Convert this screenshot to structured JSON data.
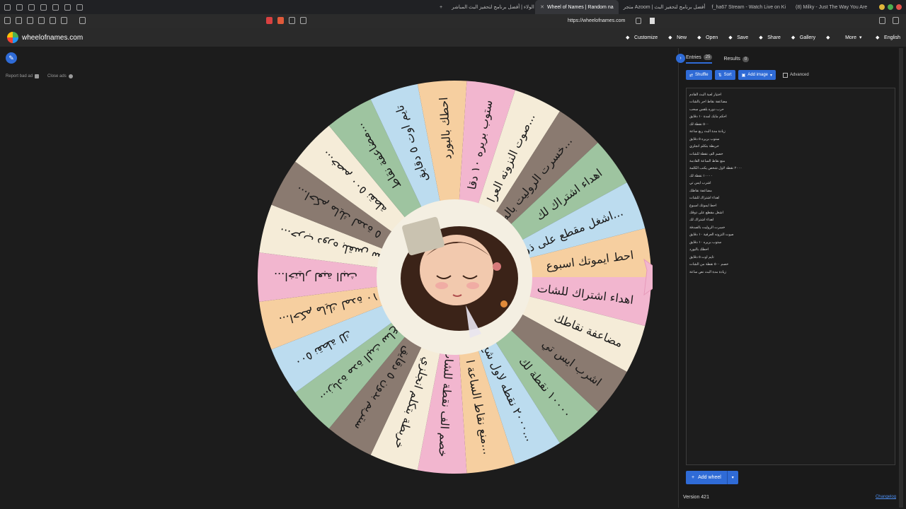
{
  "browser": {
    "tabs": [
      {
        "label": "الولاء | أفضل برنامج لتحفيز البث المباشر",
        "active": false
      },
      {
        "label": "Wheel of Names | Random na",
        "active": true
      },
      {
        "label": "متجر Azoom | أفضل برنامج لتحفيز البث",
        "active": false
      },
      {
        "label": "f_ha67 Stream - Watch Live on Ki",
        "active": false
      },
      {
        "label": "(8) Milky - Just The Way You Are",
        "active": false
      }
    ],
    "url": "https://wheelofnames.com"
  },
  "app": {
    "brand": "wheelofnames.com",
    "menu": [
      {
        "label": "Customize",
        "icon": "palette-icon"
      },
      {
        "label": "New",
        "icon": "file-icon"
      },
      {
        "label": "Open",
        "icon": "folder-icon"
      },
      {
        "label": "Save",
        "icon": "save-icon"
      },
      {
        "label": "Share",
        "icon": "share-icon"
      },
      {
        "label": "Gallery",
        "icon": "search-icon"
      },
      {
        "label": "",
        "icon": "fullscreen-icon"
      },
      {
        "label": "More",
        "icon": "chevron-down-icon"
      },
      {
        "label": "English",
        "icon": "globe-icon"
      }
    ]
  },
  "left": {
    "report_ad": "Report bad ad",
    "close_ads": "Close ads"
  },
  "wheel": {
    "colors": {
      "green": "#9ec4a0",
      "cream": "#f5ecd8",
      "brown": "#8a7a70",
      "blue": "#bcdcef",
      "pink": "#f2b6cf",
      "orange": "#f6cfa0"
    },
    "segments": [
      {
        "label": "احط ايموتك اسبوع",
        "color": "orange"
      },
      {
        "label": "اهداء اشتراك للشات",
        "color": "pink"
      },
      {
        "label": "مضاعفة نقاطك",
        "color": "cream"
      },
      {
        "label": "اشرب ايس تي",
        "color": "brown"
      },
      {
        "label": "١٠٠٠٠ نقطة لك",
        "color": "green"
      },
      {
        "label": "٢٠٠٠ نقطه لاول شخ...",
        "color": "blue"
      },
      {
        "label": "منع نقاط الساعة ا...",
        "color": "orange"
      },
      {
        "label": "خصم الف نقطة للشات",
        "color": "pink"
      },
      {
        "label": "خربطة بتكلم انجلزي",
        "color": "cream"
      },
      {
        "label": "ستريم بدون ٥ دقايق",
        "color": "brown"
      },
      {
        "label": "زيادة مدة البث ساع...",
        "color": "green"
      },
      {
        "label": "٥٠٠ نقطة لك",
        "color": "blue"
      },
      {
        "label": "احكم مايك لمدة ١٠...",
        "color": "orange"
      },
      {
        "label": "اختيار لعبة البث...",
        "color": "pink"
      },
      {
        "label": "حرب دوره بلقس سح...",
        "color": "cream"
      },
      {
        "label": "احكم مايك لمدة ٥...",
        "color": "brown"
      },
      {
        "label": "خصم ٥٠٠ نقطة...",
        "color": "cream"
      },
      {
        "label": "مضاعفة نقاط...",
        "color": "green"
      },
      {
        "label": "تايم اوت ٥ دقايق",
        "color": "blue"
      },
      {
        "label": "احطك بالبورد",
        "color": "orange"
      },
      {
        "label": "ستوب بريره ١٠ دقا",
        "color": "pink"
      },
      {
        "label": "صوت النزونه العرا...",
        "color": "cream"
      },
      {
        "label": "خسرت الروليت باله...",
        "color": "brown"
      },
      {
        "label": "اهداء اشتراك لك",
        "color": "green"
      },
      {
        "label": "اشغل مقطع على ذوق...",
        "color": "blue"
      }
    ]
  },
  "panel": {
    "tabs": [
      {
        "label": "Entries",
        "count": "25"
      },
      {
        "label": "Results",
        "count": "0"
      }
    ],
    "shuffle": "Shuffle",
    "sort": "Sort",
    "add_image": "Add image",
    "advanced": "Advanced",
    "entries": [
      "اختيار لعبة البث القادم",
      "مضاعفة نقاط اجر بالشات",
      "حرب دوره بلقس سحب",
      "احكم مايك لمدة ١٠ دقايق",
      "٥٠٠ نقطة لك",
      "زيادة مدة البث ربع ساعة",
      "ستوب بريره ٥ دقايق",
      "خربطة بتكلم انجلزي",
      "خصم الف نقطة للشات",
      "منع نقاط الساعة القادمة",
      "٢٠٠٠ نقطه لاول شخص يكتب الكلمة",
      "١٠٠٠٠ نقطة لك",
      "اشرب ايس تي",
      "مضاعفة نقاطك",
      "اهداء اشتراك للشات",
      "احط ايموتك اسبوع",
      "اشغل مقطع على ذوقك",
      "اهداء اشتراك لك",
      "خسرت الروليت بالصدفة",
      "صوت النزونه العرفية ١٠ دقايق",
      "ستوب بريره ١٠ دقايق",
      "احطك بالبورد",
      "تايم اوت ٥ دقايق",
      "خصم ٥٠٠ نقطة من الشات",
      "زيادة مدة البث نص ساعة"
    ],
    "add_wheel": "Add wheel",
    "version": "Version 421",
    "changelog": "Changelog"
  }
}
